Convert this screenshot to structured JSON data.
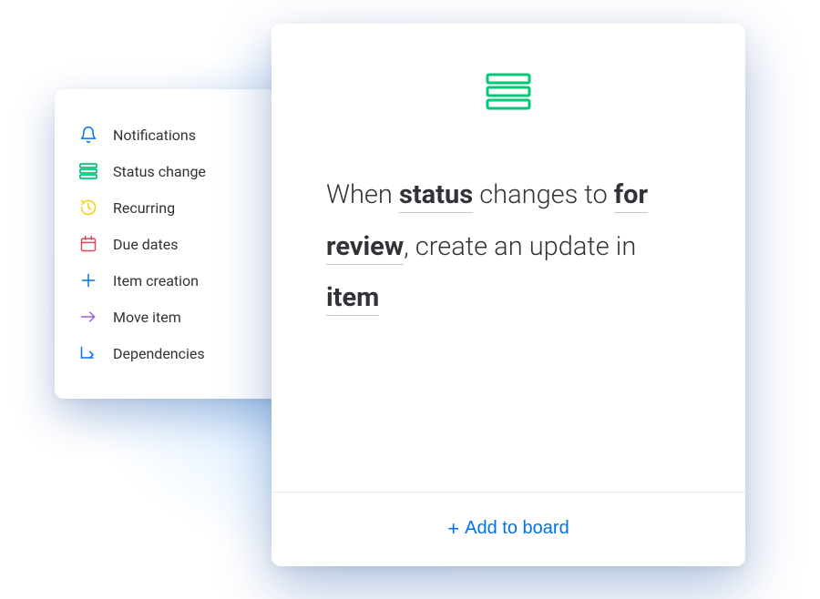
{
  "sidebar": {
    "items": [
      {
        "label": "Notifications",
        "icon": "bell-icon",
        "color": "#0073ea"
      },
      {
        "label": "Status change",
        "icon": "status-bars-icon",
        "color": "#00c875"
      },
      {
        "label": "Recurring",
        "icon": "recurring-icon",
        "color": "#ffcb00"
      },
      {
        "label": "Due dates",
        "icon": "calendar-icon",
        "color": "#e2445c"
      },
      {
        "label": "Item creation",
        "icon": "plus-icon",
        "color": "#0073ea"
      },
      {
        "label": "Move item",
        "icon": "arrow-right-icon",
        "color": "#a25ddc"
      },
      {
        "label": "Dependencies",
        "icon": "dependencies-icon",
        "color": "#0073ea"
      }
    ]
  },
  "main": {
    "icon": "status-bars-icon",
    "icon_color": "#00c875",
    "rule": {
      "part1": "When ",
      "field1": "status",
      "part2": " changes to ",
      "field2": "for review",
      "part3": ", create an update in ",
      "field3": "item"
    },
    "add_button": "Add to board"
  }
}
